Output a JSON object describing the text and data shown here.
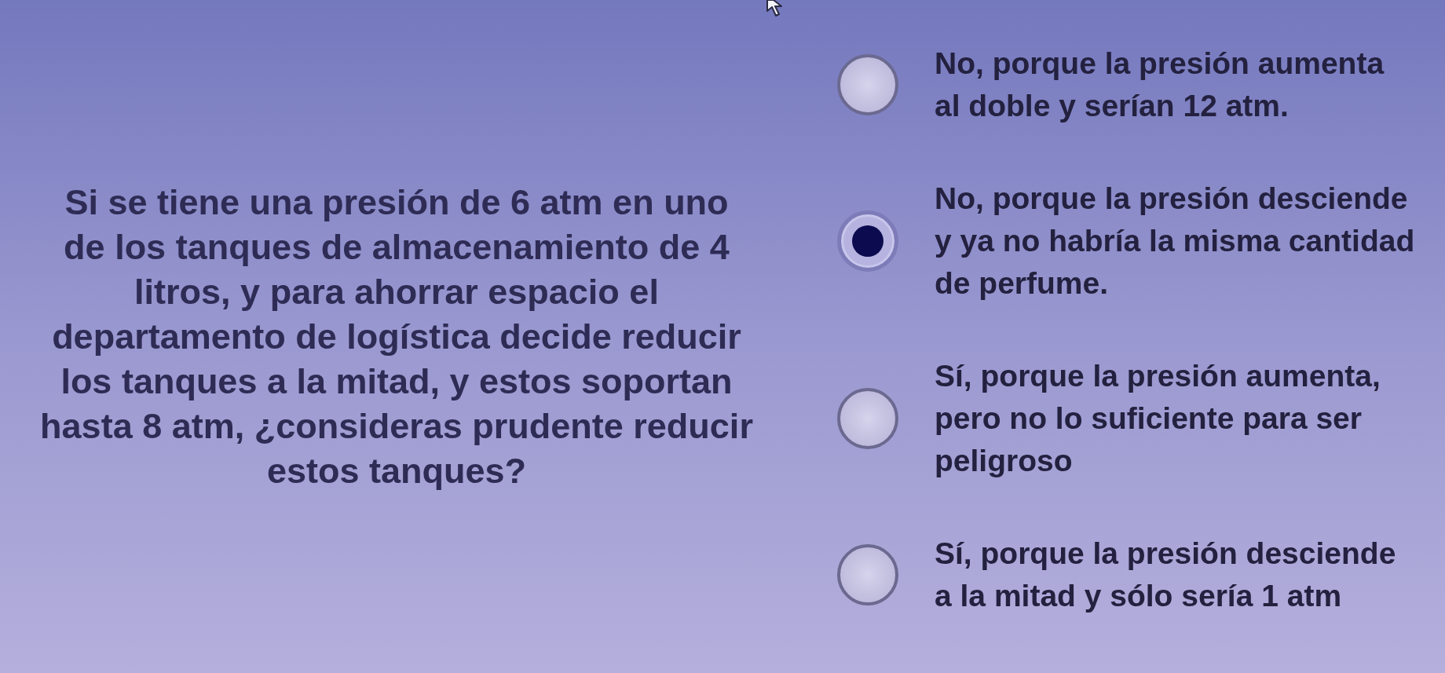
{
  "question": "Si se tiene una presión de 6 atm en uno\nde los tanques de almacenamiento de 4\nlitros, y para ahorrar espacio el\ndepartamento de logística decide reducir\nlos tanques a la mitad, y estos soportan\nhasta 8 atm, ¿consideras prudente reducir\nestos tanques?",
  "options": [
    {
      "label": "No, porque la presión aumenta\nal doble y serían 12 atm.",
      "selected": false
    },
    {
      "label": "No, porque la presión desciende\ny ya no habría la misma cantidad\nde perfume.",
      "selected": true
    },
    {
      "label": "Sí, porque la presión aumenta,\npero no lo suficiente para ser\npeligroso",
      "selected": false
    },
    {
      "label": "Sí, porque la presión desciende\na la mitad y sólo sería 1 atm",
      "selected": false
    }
  ]
}
